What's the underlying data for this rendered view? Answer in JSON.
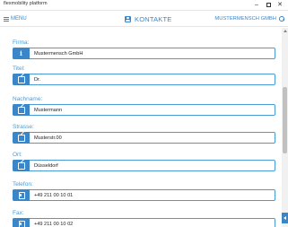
{
  "window": {
    "title": "flexmobility platform",
    "controls": {
      "minimize": "–",
      "close": "✕"
    }
  },
  "topbar": {
    "menu_label": "MENU",
    "page_title": "KONTAKTE",
    "company_label": "MUSTERMENSCH GMBH",
    "accent_color": "#3a86c8"
  },
  "form": {
    "fields": [
      {
        "label": "Firma:",
        "value": "Mustermensch GmbH",
        "icon": "info-icon"
      },
      {
        "label": "Titel:",
        "value": "Dr.",
        "icon": "edit-icon"
      },
      {
        "label": "Nachname:",
        "value": "Mustermann",
        "icon": "edit-icon"
      },
      {
        "label": "Strasse:",
        "value": "Musterstr.00",
        "icon": "edit-icon"
      },
      {
        "label": "Ort:",
        "value": "Düsseldorf",
        "icon": "edit-icon"
      },
      {
        "label": "Telefon:",
        "value": "+49 211 00 10 01",
        "icon": "phone-icon"
      },
      {
        "label": "Fax:",
        "value": "+49 211 00 10 02",
        "icon": "phone-icon"
      }
    ]
  }
}
